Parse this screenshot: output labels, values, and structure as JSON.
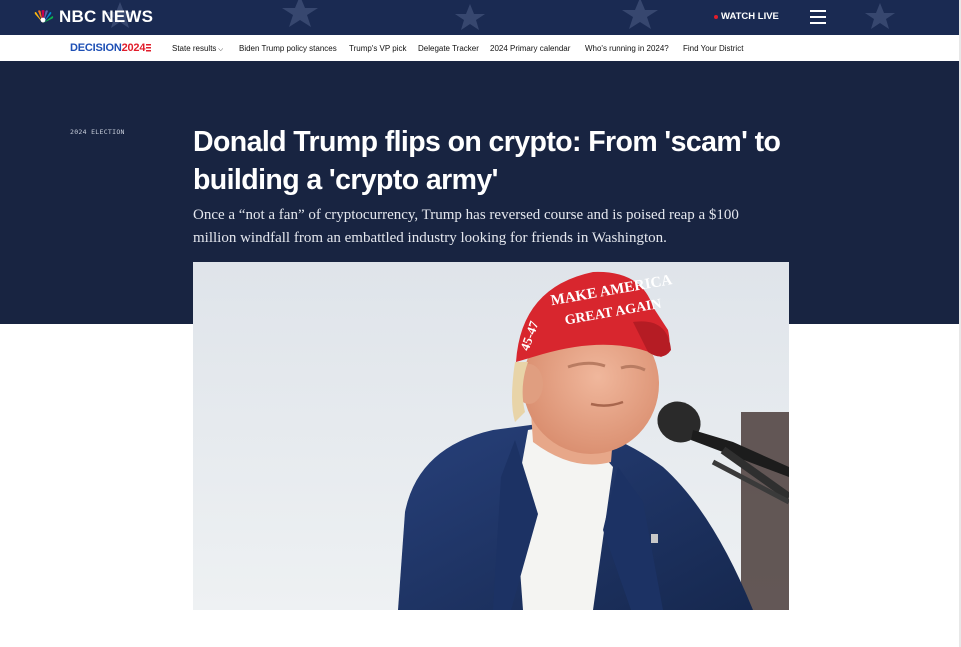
{
  "header": {
    "logo_text": "NBC NEWS",
    "watch_label": "WATCH LIVE",
    "colors": {
      "background": "#1a2a52",
      "live_dot": "#e11d2b"
    }
  },
  "nav": {
    "decision_part1": "DECISION",
    "decision_part2": "2024",
    "links": [
      {
        "label": "State results",
        "has_dropdown": true
      },
      {
        "label": "Biden Trump policy stances"
      },
      {
        "label": "Trump's VP pick"
      },
      {
        "label": "Delegate Tracker"
      },
      {
        "label": "2024 Primary calendar"
      },
      {
        "label": "Who's running in 2024?"
      },
      {
        "label": "Find Your District"
      }
    ]
  },
  "article": {
    "kicker": "2024 ELECTION",
    "headline": "Donald Trump flips on crypto: From 'scam' to building a 'crypto army'",
    "dek": "Once a “not a fan” of cryptocurrency, Trump has reversed course and is poised reap a $100 million windfall from an embattled industry looking for friends in Washington.",
    "hero_color": "#182441"
  },
  "photo": {
    "hat_text_line1": "MAKE AMERICA",
    "hat_text_line2": "GREAT AGAIN",
    "hat_side_text": "45-47",
    "colors": {
      "hat": "#d8262e",
      "suit": "#1f3566",
      "sky": "#e9edf0"
    }
  }
}
